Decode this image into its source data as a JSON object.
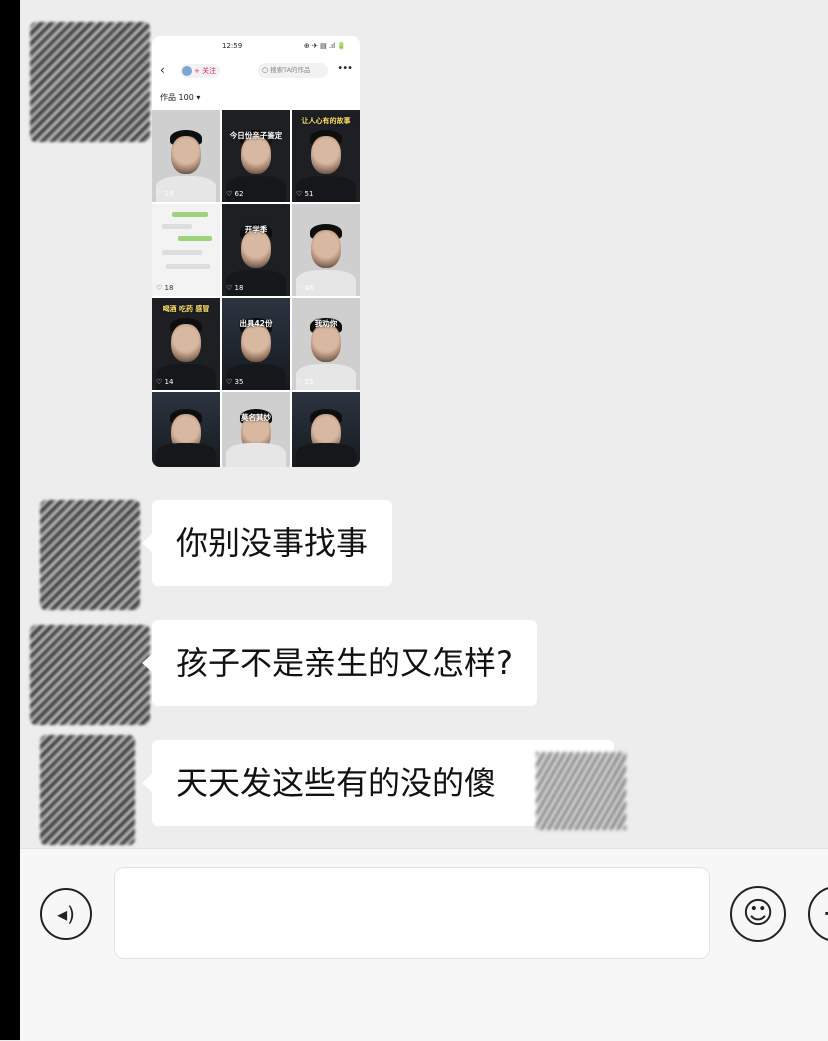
{
  "shared_screenshot": {
    "status_time": "12:59",
    "status_icons": "⊕ ✈ ▤ .ıl 🔋",
    "nav": {
      "back": "‹",
      "follow_label": "+ 关注",
      "search_placeholder": "搜索TA的作品",
      "more": "•••"
    },
    "works_label": "作品 100 ▾",
    "tiles": [
      {
        "caption": "",
        "likes": "♡ 19"
      },
      {
        "caption": "今日份亲子鉴定",
        "likes": "♡ 62"
      },
      {
        "caption": "让人心有的故事",
        "likes": "♡ 51"
      },
      {
        "caption": "",
        "likes": "♡ 18"
      },
      {
        "caption": "开学季",
        "likes": "♡ 18"
      },
      {
        "caption": "",
        "likes": "♡ 46"
      },
      {
        "caption": "喝酒 吃药 感冒",
        "likes": "♡ 14"
      },
      {
        "caption": "出具42份",
        "likes": "♡ 35"
      },
      {
        "caption": "我劝你",
        "likes": "♡ 55"
      },
      {
        "caption": "",
        "likes": ""
      },
      {
        "caption": "莫名其妙",
        "likes": ""
      },
      {
        "caption": "",
        "likes": ""
      }
    ]
  },
  "messages": [
    {
      "text": "你别没事找事"
    },
    {
      "text": "孩子不是亲生的又怎样?"
    },
    {
      "text": "天天发这些有的没的傻"
    }
  ],
  "input_bar": {
    "voice_icon": "voice-icon",
    "emoji_icon": "emoji-icon",
    "plus_icon": "plus-icon"
  }
}
